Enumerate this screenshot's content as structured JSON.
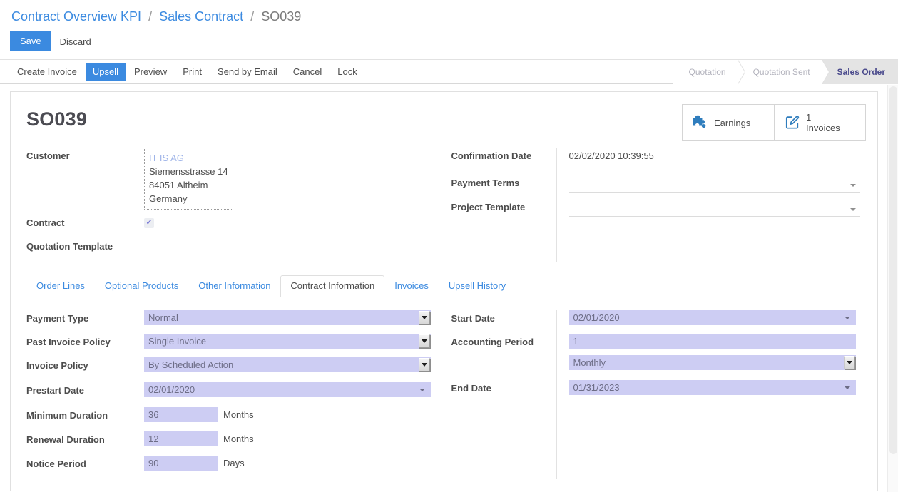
{
  "breadcrumb": {
    "items": [
      {
        "label": "Contract Overview KPI",
        "link": true
      },
      {
        "label": "Sales Contract",
        "link": true
      },
      {
        "label": "SO039",
        "link": false
      }
    ],
    "separator": "/"
  },
  "editbar": {
    "save_label": "Save",
    "discard_label": "Discard"
  },
  "toolbar": {
    "buttons": [
      {
        "label": "Create Invoice",
        "active": false
      },
      {
        "label": "Upsell",
        "active": true
      },
      {
        "label": "Preview",
        "active": false
      },
      {
        "label": "Print",
        "active": false
      },
      {
        "label": "Send by Email",
        "active": false
      },
      {
        "label": "Cancel",
        "active": false
      },
      {
        "label": "Lock",
        "active": false
      }
    ]
  },
  "statusbar": {
    "steps": [
      {
        "label": "Quotation",
        "active": false
      },
      {
        "label": "Quotation Sent",
        "active": false
      },
      {
        "label": "Sales Order",
        "active": true
      }
    ]
  },
  "record": {
    "title": "SO039"
  },
  "stat_buttons": [
    {
      "icon": "puzzle-piece-icon",
      "value": "",
      "label": "Earnings"
    },
    {
      "icon": "edit-square-icon",
      "value": "1",
      "label": "Invoices"
    }
  ],
  "top_form": {
    "left": [
      {
        "label": "Customer",
        "type": "address",
        "address": [
          "IT IS AG",
          "Siemensstrasse 14",
          "84051 Altheim",
          "Germany"
        ]
      },
      {
        "label": "Contract",
        "type": "checkbox",
        "checked": true,
        "check_glyph": "✔"
      },
      {
        "label": "Quotation Template",
        "type": "empty"
      }
    ],
    "right": [
      {
        "label": "Confirmation Date",
        "type": "text",
        "value": "02/02/2020 10:39:55"
      },
      {
        "label": "Payment Terms",
        "type": "m2o",
        "value": ""
      },
      {
        "label": "Project Template",
        "type": "m2o",
        "value": ""
      }
    ]
  },
  "notebook": {
    "tabs": [
      {
        "label": "Order Lines",
        "active": false
      },
      {
        "label": "Optional Products",
        "active": false
      },
      {
        "label": "Other Information",
        "active": false
      },
      {
        "label": "Contract Information",
        "active": true
      },
      {
        "label": "Invoices",
        "active": false
      },
      {
        "label": "Upsell History",
        "active": false
      }
    ]
  },
  "contract_information": {
    "left": [
      {
        "label": "Payment Type",
        "value": "Normal",
        "control": "select"
      },
      {
        "label": "Past Invoice Policy",
        "value": "Single Invoice",
        "control": "select"
      },
      {
        "label": "Invoice Policy",
        "value": "By Scheduled Action",
        "control": "select"
      },
      {
        "label": "Prestart Date",
        "value": "02/01/2020",
        "control": "date"
      },
      {
        "label": "Minimum Duration",
        "value": "36",
        "control": "number",
        "unit": "Months"
      },
      {
        "label": "Renewal Duration",
        "value": "12",
        "control": "number",
        "unit": "Months"
      },
      {
        "label": "Notice Period",
        "value": "90",
        "control": "number",
        "unit": "Days"
      }
    ],
    "right": [
      {
        "label": "Start Date",
        "value": "02/01/2020",
        "control": "date"
      },
      {
        "label": "Accounting Period",
        "value": "1",
        "control": "number_wide",
        "second_value": "Monthly",
        "second_control": "select"
      },
      {
        "label": "End Date",
        "value": "01/31/2023",
        "control": "date"
      }
    ]
  },
  "colors": {
    "accent": "#3b8ae0",
    "field_bg": "#cdcdf3",
    "link": "#3b8ae0",
    "text": "#4c4c4c"
  }
}
